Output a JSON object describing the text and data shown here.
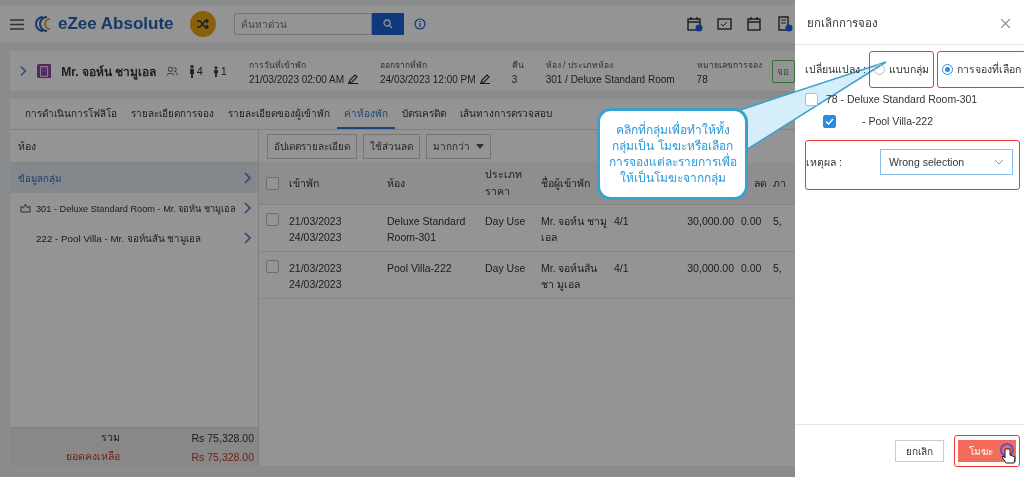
{
  "topbar": {
    "brand": "eZee Absolute",
    "search": {
      "placeholder": "ค้นหาด่วน"
    }
  },
  "guest_header": {
    "name": "Mr. จอห์น ชามูเอล",
    "adults": "4",
    "children": "1",
    "fields": [
      {
        "label": "การวันที่เข้าพัก",
        "value": "21/03/2023 02:00 AM",
        "editable": true
      },
      {
        "label": "ออกจากที่พัก",
        "value": "24/03/2023 12:00 PM",
        "editable": true
      },
      {
        "label": "คืน",
        "value": "3",
        "editable": false
      },
      {
        "label": "ห้อง / ประเภทห้อง",
        "value": "301 / Deluxe Standard Room",
        "editable": false
      },
      {
        "label": "หมายเลขการจอง",
        "value": "78",
        "editable": false
      }
    ],
    "status": "จอ"
  },
  "tabs": [
    {
      "label": "การดำเนินการโฟลิโอ",
      "selected": false
    },
    {
      "label": "รายละเอียดการจอง",
      "selected": false
    },
    {
      "label": "รายละเอียดของผู้เข้าพัก",
      "selected": false
    },
    {
      "label": "ค่าห้องพัก",
      "selected": true
    },
    {
      "label": "บัตรเครดิต",
      "selected": false
    },
    {
      "label": "เส้นทางการตรวจสอบ",
      "selected": false
    }
  ],
  "rooms_panel": {
    "title": "ห้อง",
    "items": [
      {
        "label": "ข้อมูลกลุ่ม",
        "kind": "group",
        "selected": true
      },
      {
        "label": "301 - Deluxe Standard Room - Mr. จอห์น ชามูเอล",
        "kind": "master",
        "selected": false
      },
      {
        "label": "222 - Pool Villa - Mr. จอห์นสัน ชามูเอล",
        "kind": "room",
        "selected": false
      }
    ],
    "totals": [
      {
        "label": "รวม",
        "value": "Rs 75,328.00",
        "kind": "total"
      },
      {
        "label": "ยอดคงเหลือ",
        "value": "Rs 75,328.00",
        "kind": "balance"
      }
    ]
  },
  "toolbar": {
    "buttons": [
      "อัปเดตรายละเอียด",
      "ใช้ส่วนลด"
    ],
    "more_menu": "มากกว่า"
  },
  "table": {
    "all_checked": false,
    "columns": [
      "เข้าพัก",
      "ห้อง",
      "ประเภท ราคา",
      "ชื่อผู้เข้าพัก",
      null,
      null,
      "ลด",
      "ภา"
    ],
    "rows": [
      {
        "checked": false,
        "cells": [
          [
            "21/03/2023",
            "24/03/2023"
          ],
          "Deluxe Standard Room-301",
          "Day Use",
          "Mr. จอห์น ชามู เอล",
          "4/1",
          "30,000.00",
          "0.00",
          "5,"
        ]
      },
      {
        "checked": false,
        "cells": [
          [
            "21/03/2023",
            "24/03/2023"
          ],
          "Pool Villa-222",
          "Day Use",
          "Mr. จอห์นสัน ชา มูเอล",
          "4/1",
          "30,000.00",
          "0.00",
          "5,"
        ]
      }
    ]
  },
  "callout": {
    "text": "คลิกที่กลุ่มเพื่อทำให้ทั้งกลุ่มเป็น โมฆะหรือเลือกการจองแต่ละรายการเพื่อให้เป็นโมฆะจากกลุ่ม"
  },
  "drawer": {
    "title": "ยกเลิกการจอง",
    "change_label": "เปลี่ยนแปลง :",
    "options": [
      {
        "label": "แบบกลุ่ม",
        "selected": false,
        "highlighted": true
      },
      {
        "label": "การจองที่เลือก",
        "selected": true,
        "highlighted": true
      }
    ],
    "bookings": [
      {
        "label": "78 - Deluxe Standard Room-301",
        "checked": false
      },
      {
        "label": "- Pool Villa-222",
        "checked": true
      }
    ],
    "reason": {
      "label": "เหตุผล :",
      "value": "Wrong selection",
      "highlighted": true
    },
    "buttons": [
      {
        "label": "ยกเลิก",
        "kind": "secondary",
        "highlighted": false
      },
      {
        "label": "โมฆะ",
        "kind": "primary",
        "highlighted": true
      }
    ]
  }
}
